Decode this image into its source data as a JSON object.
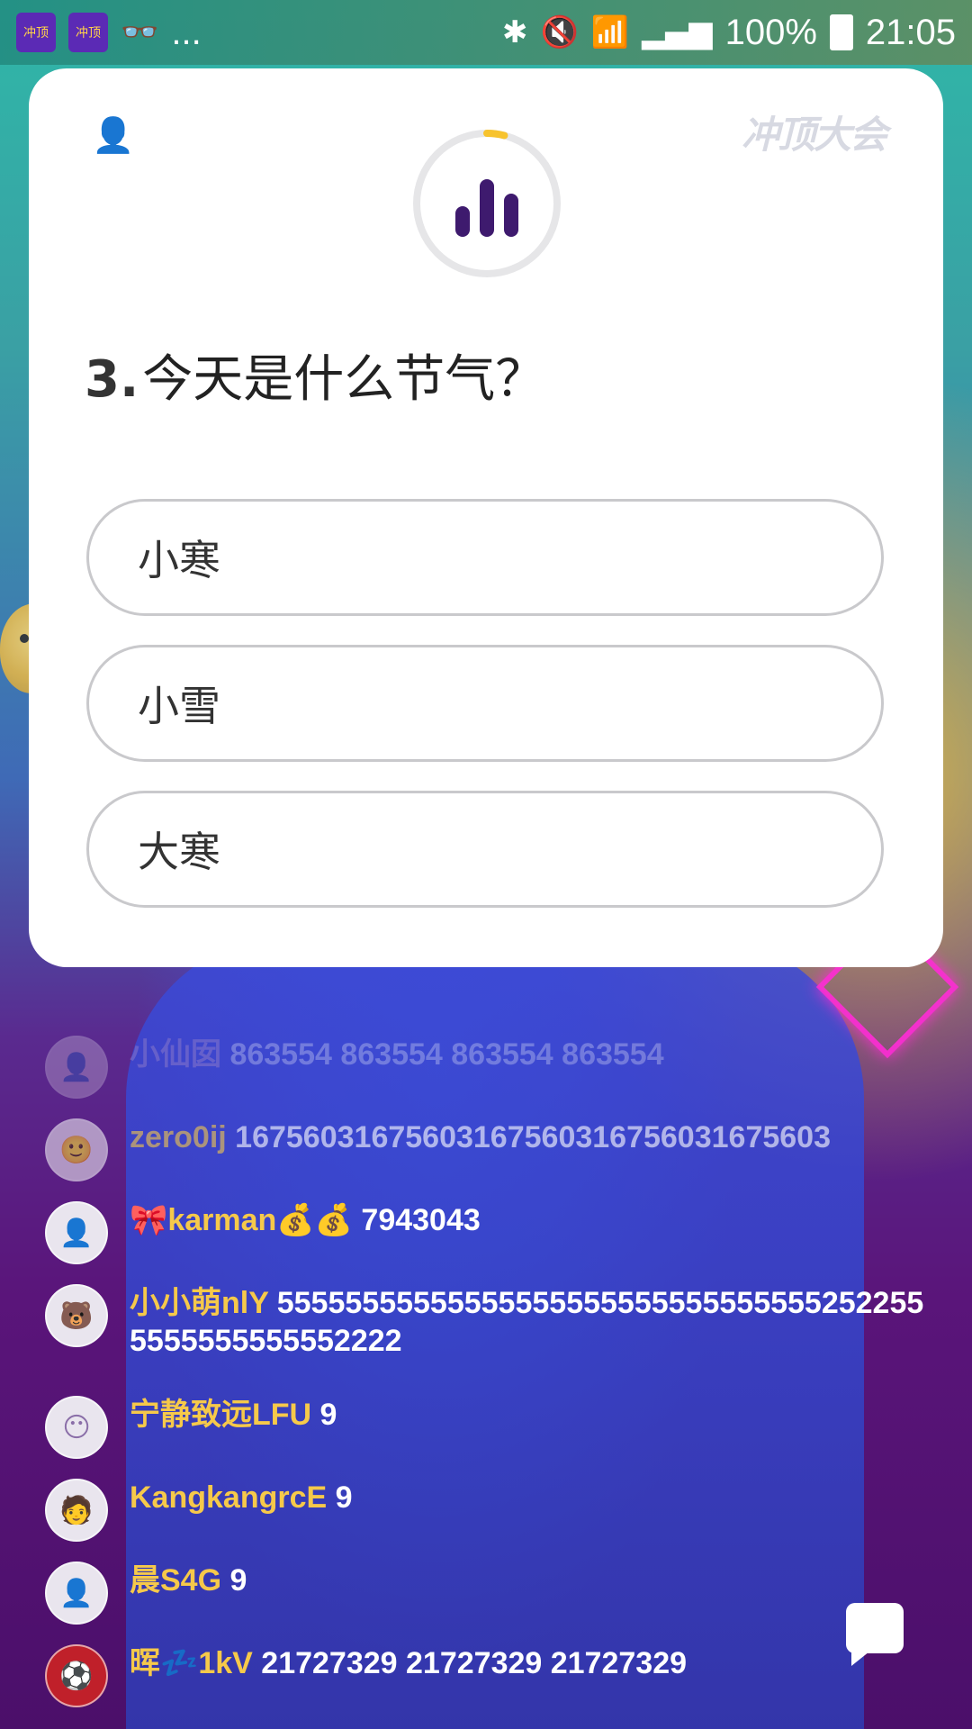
{
  "status_bar": {
    "app_icon_1": "冲顶",
    "app_icon_2": "冲顶",
    "more": "...",
    "battery_pct": "100%",
    "time": "21:05"
  },
  "quiz": {
    "logo": "冲顶大会",
    "question_number": "3.",
    "question_text": "今天是什么节气？",
    "options": [
      {
        "label": "小寒"
      },
      {
        "label": "小雪"
      },
      {
        "label": "大寒"
      }
    ],
    "timer_progress": 0.04,
    "accent_color": "#f7c32e",
    "brand_color": "#3e1a6e"
  },
  "comments": [
    {
      "name": "小仙囡",
      "message": "863554  863554  863554  863554"
    },
    {
      "name": "zero0ij",
      "message": "16756031675603167560316756031675603"
    },
    {
      "name": "🎀karman💰💰",
      "message": "7943043"
    },
    {
      "name": "小小萌nlY",
      "message": "555555555555555555555555555555552522555555555555552222"
    },
    {
      "name": "宁静致远LFU",
      "message": "9"
    },
    {
      "name": "KangkangrcE",
      "message": "9"
    },
    {
      "name": "晨S4G",
      "message": "9"
    },
    {
      "name": "晖💤1kV",
      "message": "21727329  21727329  21727329"
    }
  ]
}
